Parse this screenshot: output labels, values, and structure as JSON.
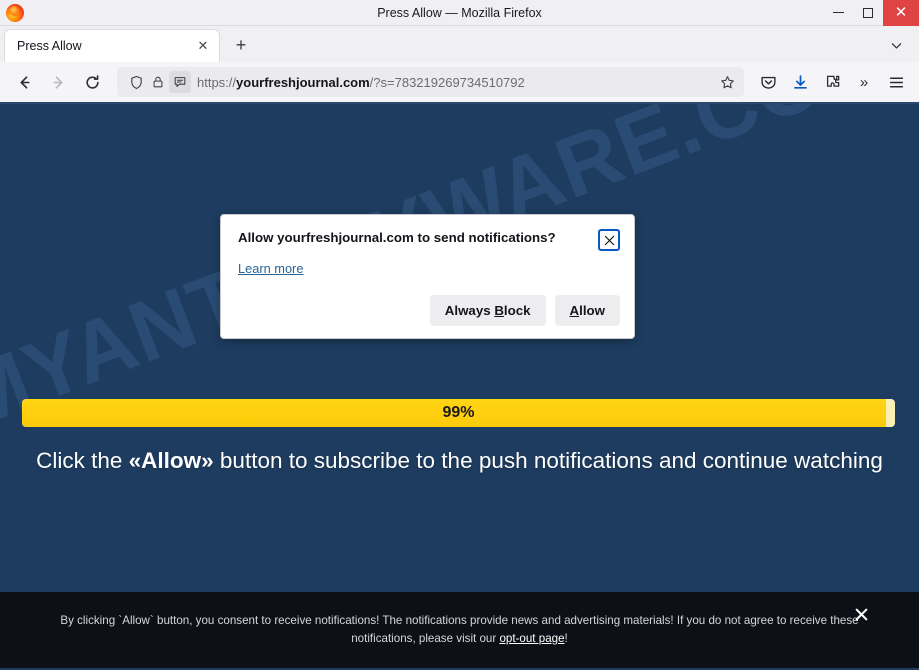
{
  "window": {
    "title": "Press Allow — Mozilla Firefox",
    "controls": {
      "minimize": "—",
      "maximize": "□",
      "close": "✕"
    }
  },
  "tabs": {
    "items": [
      {
        "label": "Press Allow",
        "close_label": "✕"
      }
    ],
    "new_tab_label": "+",
    "list_all_label": "⌄"
  },
  "toolbar": {
    "back_label": "←",
    "forward_label": "→",
    "reload_label": "⟳",
    "url_prefix": "https://",
    "url_host": "yourfreshjournal.com",
    "url_path": "/?s=783219269734510792",
    "bookmark_label": "☆",
    "pocket_label": "pocket",
    "download_label": "download",
    "extensions_label": "extensions",
    "overflow_label": "»",
    "menu_label": "≡"
  },
  "doorhanger": {
    "title": "Allow yourfreshjournal.com to send notifications?",
    "learn_more": "Learn more",
    "always_block": {
      "pre": "Always ",
      "key": "B",
      "post": "lock"
    },
    "allow": {
      "pre": "",
      "key": "A",
      "post": "llow"
    },
    "close_label": "✕"
  },
  "page": {
    "watermark": "MYANTISPYWARE.COM",
    "progress": {
      "percent": 99,
      "label": "99%"
    },
    "headline": {
      "before": "Click the ",
      "emphasis": "«Allow»",
      "after": " button to subscribe to the push notifications and continue watching"
    },
    "background_color": "#1e3c5f",
    "accent_color": "#fccb09"
  },
  "banner": {
    "text_before": "By clicking `Allow` button, you consent to receive notifications! The notifications provide news and advertising materials! If you do not agree to receive these notifications, please visit our ",
    "link": "opt-out page",
    "text_after": "!",
    "close_label": "✕"
  }
}
